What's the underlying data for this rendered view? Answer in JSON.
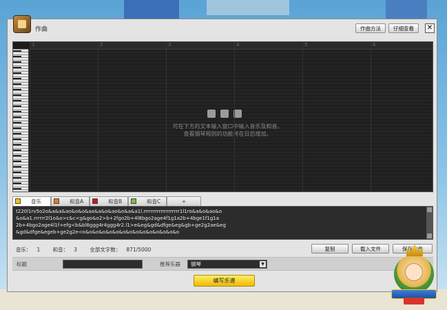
{
  "window": {
    "title": "作曲",
    "compose_method_label": "作曲方法",
    "details_label": "仔细查看",
    "close_glyph": "✕"
  },
  "piano_roll": {
    "measures": [
      "1",
      "2",
      "3",
      "4",
      "5",
      "6"
    ],
    "hint_line_1": "可在下方的文本输入窗口中输入音乐及和音。",
    "hint_line_2": "查看钢琴规则的功能将在日后增加。"
  },
  "tabs": [
    {
      "label": "音乐",
      "color": "#f4c400",
      "active": true
    },
    {
      "label": "和音A",
      "color": "#e87820",
      "active": false
    },
    {
      "label": "和音B",
      "color": "#d01818",
      "active": false
    },
    {
      "label": "和音C",
      "color": "#7cbc3c",
      "active": false
    },
    {
      "label": "+",
      "color": "",
      "active": false
    }
  ],
  "editor": {
    "lines": [
      "t220l1rv5o2o&a&a&ao&o&o&aa&a&o&ao&o&a&a1l.rrrrrrrrrrrrrrrrrrr1l1ro&a&o&ao&o",
      "&o&a1.rrrrrr2l1o&o>c&c<g&go&o2>b+2fgo2b+4l8bgo2age4f1g1a2b+4bge1f1g1a",
      "2b+4bgo2age4l1f+efg<b&bl8ggg4r4ggg4r2.l1>e&eg&gd&dfge&eg&gb+ge2g2ae&eg",
      "&gd&dfge&egeb+ge2g2e<o&o&o&o&o&o&o&o&o&o&o&o&o&o&o"
    ]
  },
  "stats": {
    "music_label": "音乐：",
    "music_count": "1",
    "chord_label": "和音：",
    "chord_count": "3",
    "chars_label": "全部文字数：",
    "chars_value": "871/5000"
  },
  "actions": {
    "copy": "复制",
    "load_file": "载入文件",
    "save_file": "保存文件"
  },
  "fields": {
    "title_label": "标题",
    "title_value": "",
    "instrument_label": "推荐乐器",
    "instrument_value": "钢琴"
  },
  "primary_button": "编写乐谱"
}
